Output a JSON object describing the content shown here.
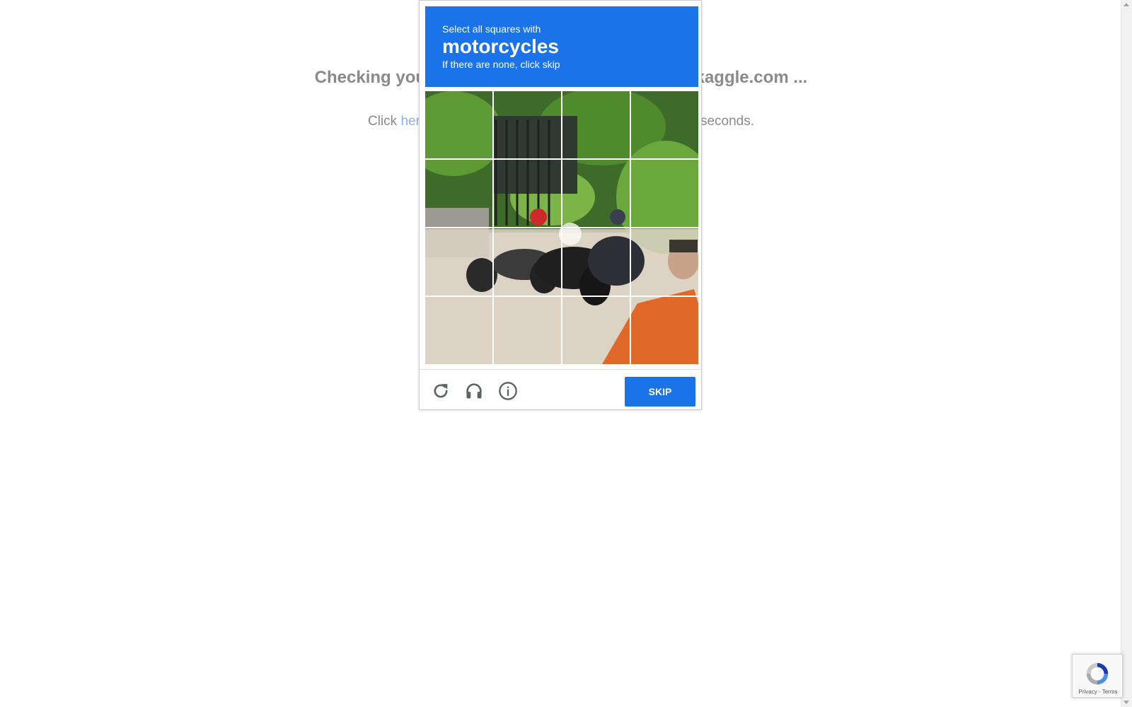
{
  "background": {
    "heading": "Checking your browser before accessing www.kaggle.com ...",
    "subtext_before": "Click ",
    "subtext_link": "here",
    "subtext_after": " if you are not automatically redirected after 5 seconds."
  },
  "captcha": {
    "instruction": "Select all squares with",
    "target": "motorcycles",
    "hint": "If there are none, click skip",
    "grid": {
      "rows": 4,
      "cols": 4
    },
    "footer": {
      "reload_icon": "reload-icon",
      "audio_icon": "headphones-icon",
      "info_icon": "info-icon",
      "skip_label": "SKIP"
    },
    "colors": {
      "header": "#1a73e8",
      "button": "#1a73e8"
    }
  },
  "badge": {
    "text": "Privacy - Terms"
  }
}
